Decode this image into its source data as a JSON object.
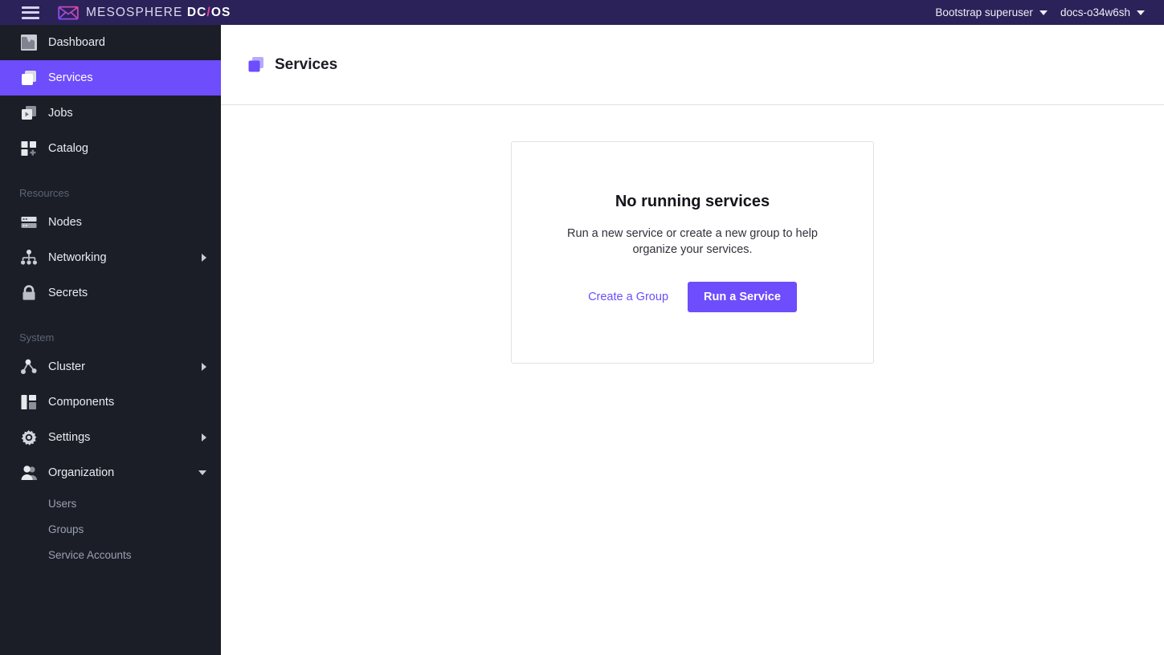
{
  "topbar": {
    "menu_icon": "hamburger-icon",
    "logo_icon": "mesosphere-logo-icon",
    "brand_prefix": "MESOSPHERE",
    "brand_dc": "DC",
    "brand_slash": "/",
    "brand_os": "OS",
    "user_menu": "Bootstrap superuser",
    "cluster_menu": "docs-o34w6sh"
  },
  "sidebar": {
    "items": [
      {
        "label": "Dashboard",
        "icon": "dashboard-icon",
        "active": false,
        "expandable": false
      },
      {
        "label": "Services",
        "icon": "services-icon",
        "active": true,
        "expandable": false
      },
      {
        "label": "Jobs",
        "icon": "jobs-icon",
        "active": false,
        "expandable": false
      },
      {
        "label": "Catalog",
        "icon": "catalog-icon",
        "active": false,
        "expandable": false
      }
    ],
    "resources_label": "Resources",
    "resources_items": [
      {
        "label": "Nodes",
        "icon": "nodes-icon",
        "expandable": false
      },
      {
        "label": "Networking",
        "icon": "networking-icon",
        "expandable": true
      },
      {
        "label": "Secrets",
        "icon": "secrets-lock-icon",
        "expandable": false
      }
    ],
    "system_label": "System",
    "system_items": [
      {
        "label": "Cluster",
        "icon": "cluster-icon",
        "expandable": true
      },
      {
        "label": "Components",
        "icon": "components-icon",
        "expandable": false
      },
      {
        "label": "Settings",
        "icon": "gear-icon",
        "expandable": true
      },
      {
        "label": "Organization",
        "icon": "organization-user-icon",
        "expandable": true,
        "expanded": true
      }
    ],
    "organization_subitems": [
      {
        "label": "Users"
      },
      {
        "label": "Groups"
      },
      {
        "label": "Service Accounts"
      }
    ]
  },
  "page": {
    "icon": "services-icon",
    "title": "Services"
  },
  "empty_state": {
    "title": "No running services",
    "description": "Run a new service or create a new group to help organize your services.",
    "secondary_action": "Create a Group",
    "primary_action": "Run a Service"
  },
  "colors": {
    "topbar_bg": "#2b2259",
    "sidebar_bg": "#1b1e27",
    "accent_purple": "#6d4dfc",
    "brand_pink": "#e0489f",
    "border_gray": "#dfe1e6",
    "muted_text": "#5c6475"
  }
}
